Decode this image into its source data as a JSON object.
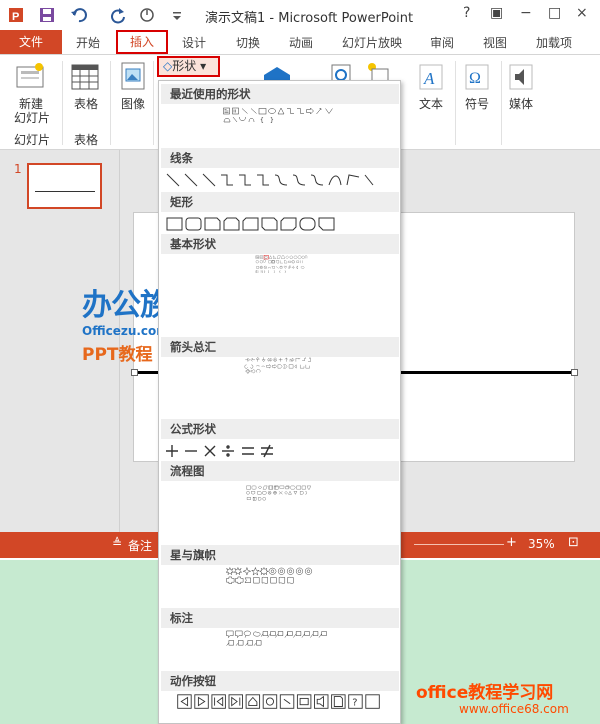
{
  "window": {
    "title": "演示文稿1 - Microsoft PowerPoint",
    "controls": [
      "?",
      "−",
      "□",
      "×"
    ]
  },
  "tabs": [
    "文件",
    "开始",
    "插入",
    "设计",
    "切换",
    "动画",
    "幻灯片放映",
    "审阅",
    "视图",
    "加载项"
  ],
  "ribbon": {
    "new_slide_label_1": "新建",
    "new_slide_label_2": "幻灯片",
    "table_label": "表格",
    "image_label": "图像",
    "group_slides": "幻灯片",
    "group_tables": "表格",
    "shapes_button": "形状",
    "text_label": "文本",
    "symbol_label": "符号",
    "media_label": "媒体"
  },
  "thumbnail": {
    "number": "1"
  },
  "status": {
    "notes": "备注",
    "zoom": "35%"
  },
  "shapes_menu": {
    "sections": [
      "最近使用的形状",
      "线条",
      "矩形",
      "基本形状",
      "箭头总汇",
      "公式形状",
      "流程图",
      "星与旗帜",
      "标注",
      "动作按钮"
    ]
  },
  "watermark": {
    "logo_text": "办公族",
    "logo_url": "Officezu.com",
    "logo_ppt": "PPT教程",
    "site_name": "office教程学习网",
    "site_url": "www.office68.com"
  },
  "colors": {
    "accent": "#d24726",
    "highlight": "#d80000"
  }
}
